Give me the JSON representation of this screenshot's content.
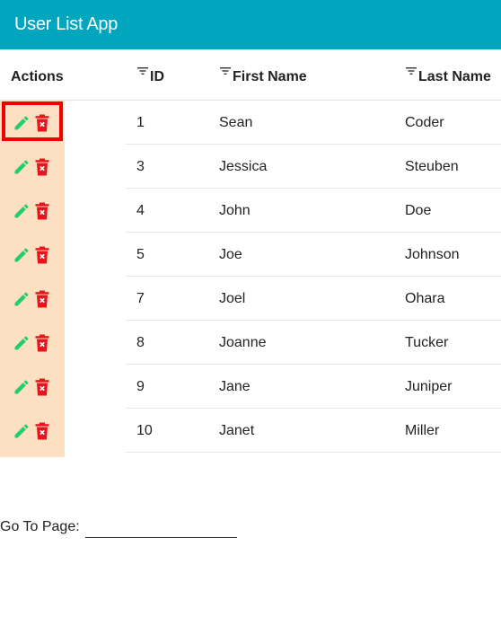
{
  "app": {
    "title": "User List App"
  },
  "table": {
    "headers": {
      "actions": "Actions",
      "id": "ID",
      "first_name": "First Name",
      "last_name": "Last Name"
    },
    "rows": [
      {
        "id": "1",
        "first_name": "Sean",
        "last_name": "Coder"
      },
      {
        "id": "3",
        "first_name": "Jessica",
        "last_name": "Steuben"
      },
      {
        "id": "4",
        "first_name": "John",
        "last_name": "Doe"
      },
      {
        "id": "5",
        "first_name": "Joe",
        "last_name": "Johnson"
      },
      {
        "id": "7",
        "first_name": "Joel",
        "last_name": "Ohara"
      },
      {
        "id": "8",
        "first_name": "Joanne",
        "last_name": "Tucker"
      },
      {
        "id": "9",
        "first_name": "Jane",
        "last_name": "Juniper"
      },
      {
        "id": "10",
        "first_name": "Janet",
        "last_name": "Miller"
      }
    ]
  },
  "pagination": {
    "goto_label": "Go To Page:",
    "goto_value": ""
  },
  "colors": {
    "appbar": "#00a6bd",
    "actions_bg": "#fde0c1",
    "edit_icon": "#1fcf6e",
    "delete_icon": "#e8141d",
    "selection": "#ee0000"
  },
  "icons": {
    "edit": "pencil-icon",
    "delete": "trash-icon",
    "sort": "filter-sort-icon"
  }
}
